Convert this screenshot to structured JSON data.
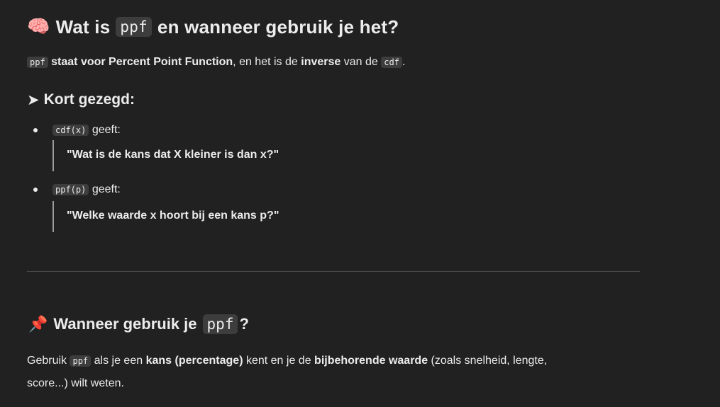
{
  "section1": {
    "emoji": "🧠",
    "title_pre": "Wat is",
    "title_code": "ppf",
    "title_post": "en wanneer gebruik je het?",
    "intro": {
      "code1": "ppf",
      "bold1": "staat voor Percent Point Function",
      "text1": ", en het is de",
      "bold2": "inverse",
      "text2": "van de",
      "code2": "cdf",
      "text3": "."
    },
    "subheading_arrow": "➤",
    "subheading": "Kort gezegd:",
    "bullets": [
      {
        "code": "cdf(x)",
        "text": "geeft:",
        "quote": "\"Wat is de kans dat X kleiner is dan x?\""
      },
      {
        "code": "ppf(p)",
        "text": "geeft:",
        "quote": "\"Welke waarde x hoort bij een kans p?\""
      }
    ]
  },
  "section2": {
    "emoji": "📌",
    "title_pre": "Wanneer gebruik je",
    "title_code": "ppf",
    "title_post": "?",
    "para": {
      "text1": "Gebruik",
      "code": "ppf",
      "text2": "als je een",
      "bold1": "kans (percentage)",
      "text3": "kent en je de",
      "bold2": "bijbehorende waarde",
      "text4": "(zoals snelheid, lengte,",
      "line2": "score...) wilt weten."
    }
  }
}
